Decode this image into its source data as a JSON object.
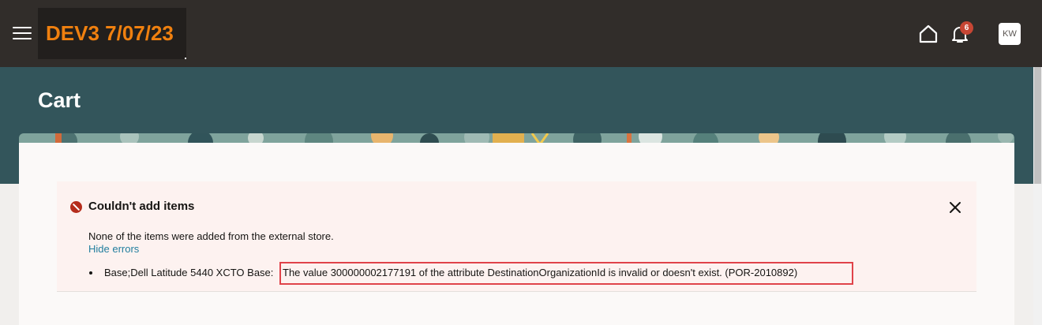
{
  "header": {
    "env_label": "DEV3 7/07/23",
    "notification_count": "6",
    "avatar_initials": "KW",
    "menu_icon": "hamburger-menu-icon",
    "home_icon": "home-icon",
    "bell_icon": "bell-icon"
  },
  "page": {
    "title": "Cart"
  },
  "alert": {
    "icon": "error-icon",
    "title": "Couldn't add items",
    "message": "None of the items were added from the external store.",
    "hide_errors_link": "Hide errors",
    "errors": [
      {
        "prefix": "Base;Dell Latitude 5440 XCTO Base:",
        "text": "The value 300000002177191 of the attribute DestinationOrganizationId is invalid or doesn't exist. (POR-2010892)"
      }
    ]
  },
  "colors": {
    "header_bg": "#312d2a",
    "env_label": "#f0800f",
    "banner_bg": "#33555b",
    "badge": "#c74634",
    "alert_bg": "#fdf2f0",
    "error_icon": "#b52d1c",
    "link": "#227e9e",
    "highlight_border": "#e0434a"
  }
}
